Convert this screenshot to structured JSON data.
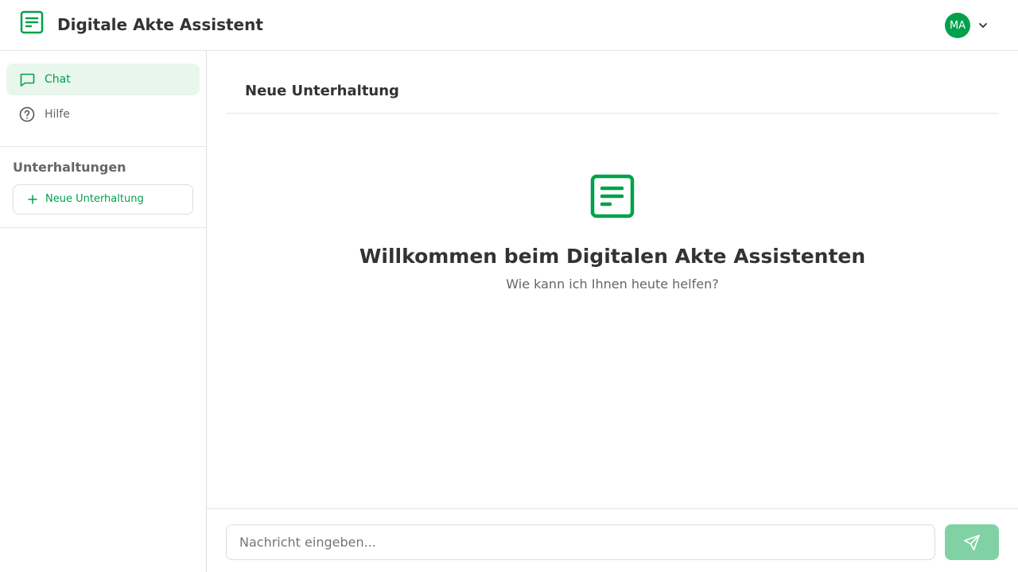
{
  "colors": {
    "accent": "#00a14b",
    "accent_light": "#e8f6ee",
    "send_disabled": "#80d2a5",
    "text_muted": "#666666"
  },
  "header": {
    "title": "Digitale Akte Assistent",
    "logo_icon": "document-icon",
    "user_initials": "MA",
    "menu_icon": "chevron-down-icon"
  },
  "sidebar": {
    "nav": [
      {
        "label": "Chat",
        "icon": "chat-bubble-icon",
        "active": true
      },
      {
        "label": "Hilfe",
        "icon": "help-circle-icon",
        "active": false
      }
    ],
    "conversations_title": "Unterhaltungen",
    "new_conversation_label": "Neue Unterhaltung"
  },
  "main": {
    "conversation_title": "Neue Unterhaltung",
    "welcome_icon": "document-icon",
    "welcome_title": "Willkommen beim Digitalen Akte Assistenten",
    "welcome_subtitle": "Wie kann ich Ihnen heute helfen?",
    "input": {
      "placeholder": "Nachricht eingeben...",
      "value": ""
    },
    "send_icon": "send-icon"
  }
}
